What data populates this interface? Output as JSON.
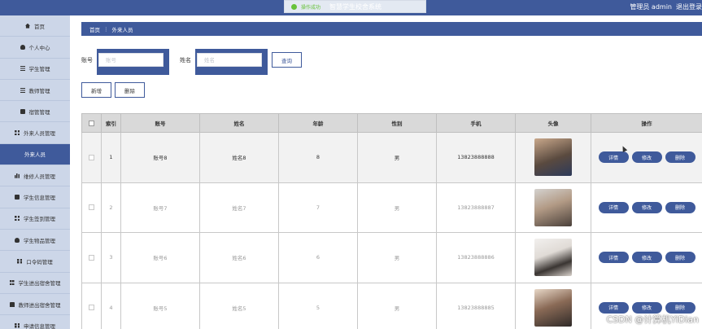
{
  "header": {
    "toast": "操作成功",
    "app_title": "智慧学生校舍系统",
    "admin_role": "管理员 admin",
    "logout": "退出登录"
  },
  "sidebar": {
    "items": [
      {
        "label": "首页",
        "icon": "home-icon"
      },
      {
        "label": "个人中心",
        "icon": "user-icon"
      },
      {
        "label": "学生管理",
        "icon": "list-icon"
      },
      {
        "label": "教师管理",
        "icon": "list-icon"
      },
      {
        "label": "宿管管理",
        "icon": "doc-icon"
      },
      {
        "label": "外来人员管理",
        "icon": "grid-icon"
      },
      {
        "label": "外来人员",
        "icon": "",
        "active": true
      },
      {
        "label": "维修人员管理",
        "icon": "bar-chart-icon"
      },
      {
        "label": "学生信息管理",
        "icon": "doc-icon"
      },
      {
        "label": "学生签到管理",
        "icon": "grid-icon"
      },
      {
        "label": "学生物品管理",
        "icon": "user-icon"
      },
      {
        "label": "口令码管理",
        "icon": "grid-icon"
      },
      {
        "label": "学生进出宿舍管理",
        "icon": "grid-icon"
      },
      {
        "label": "教师进出宿舍管理",
        "icon": "lock-icon"
      },
      {
        "label": "申请信息管理",
        "icon": "grid-icon"
      }
    ]
  },
  "breadcrumb": {
    "home": "首页",
    "sep": "⋮",
    "current": "外来人员"
  },
  "search": {
    "account_label": "账号",
    "account_placeholder": "账号",
    "name_label": "姓名",
    "name_placeholder": "姓名",
    "query_button": "查询"
  },
  "actions": {
    "add": "新增",
    "delete": "删除"
  },
  "table": {
    "headers": [
      "索引",
      "账号",
      "姓名",
      "年龄",
      "性别",
      "手机",
      "头像",
      "操作"
    ],
    "row_buttons": {
      "detail": "详情",
      "edit": "修改",
      "delete": "删除"
    },
    "rows": [
      {
        "index": "1",
        "account": "账号8",
        "name": "姓名8",
        "age": "8",
        "gender": "男",
        "phone": "13823888888",
        "avatar": "avatar-photo"
      },
      {
        "index": "2",
        "account": "账号7",
        "name": "姓名7",
        "age": "7",
        "gender": "男",
        "phone": "13823888887",
        "avatar": "avatar-photo"
      },
      {
        "index": "3",
        "account": "账号6",
        "name": "姓名6",
        "age": "6",
        "gender": "男",
        "phone": "13823888886",
        "avatar": "avatar-photo"
      },
      {
        "index": "4",
        "account": "账号5",
        "name": "姓名5",
        "age": "5",
        "gender": "男",
        "phone": "13823888885",
        "avatar": "avatar-photo"
      }
    ]
  },
  "watermark": "CSDN @计算机YiDian",
  "colors": {
    "primary": "#3f5a9b",
    "sidebar_bg": "#ccd6e8",
    "success": "#67c23a"
  }
}
